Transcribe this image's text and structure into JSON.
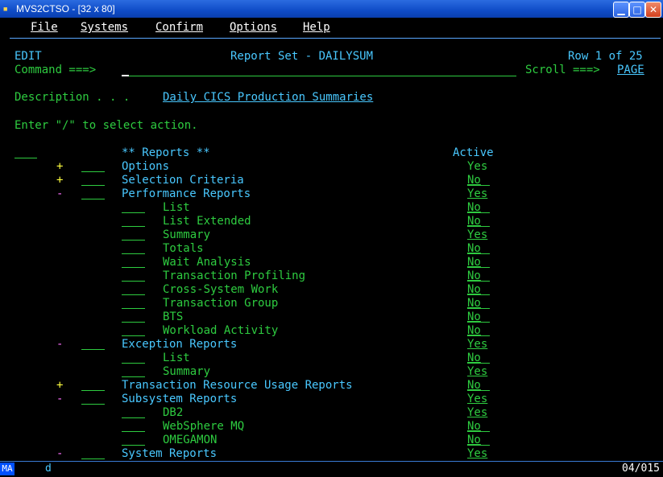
{
  "window": {
    "title": "MVS2CTSO - [32 x 80]"
  },
  "menu": [
    "File",
    "Systems",
    "Confirm",
    "Options",
    "Help"
  ],
  "header": {
    "mode": "EDIT",
    "title": "Report Set - DAILYSUM",
    "row_info": "Row 1 of 25",
    "command_label": "Command ===>",
    "scroll_label": "Scroll ===>",
    "scroll_value": "PAGE"
  },
  "description": {
    "label": "Description . . .",
    "value": "Daily CICS Production Summaries"
  },
  "instruction": "Enter \"/\" to select action.",
  "columns": {
    "reports": "** Reports **",
    "active": "Active"
  },
  "rows": [
    {
      "expander": "+",
      "name": "Options",
      "active": "Yes",
      "level": 0,
      "editable": false
    },
    {
      "expander": "+",
      "name": "Selection Criteria",
      "active": "No",
      "level": 0,
      "editable": true
    },
    {
      "expander": "-",
      "name": "Performance Reports",
      "active": "Yes",
      "level": 0,
      "editable": true
    },
    {
      "expander": "",
      "name": "List",
      "active": "No",
      "level": 1,
      "editable": true
    },
    {
      "expander": "",
      "name": "List Extended",
      "active": "No",
      "level": 1,
      "editable": true
    },
    {
      "expander": "",
      "name": "Summary",
      "active": "Yes",
      "level": 1,
      "editable": true
    },
    {
      "expander": "",
      "name": "Totals",
      "active": "No",
      "level": 1,
      "editable": true
    },
    {
      "expander": "",
      "name": "Wait Analysis",
      "active": "No",
      "level": 1,
      "editable": true
    },
    {
      "expander": "",
      "name": "Transaction Profiling",
      "active": "No",
      "level": 1,
      "editable": true
    },
    {
      "expander": "",
      "name": "Cross-System Work",
      "active": "No",
      "level": 1,
      "editable": true
    },
    {
      "expander": "",
      "name": "Transaction Group",
      "active": "No",
      "level": 1,
      "editable": true
    },
    {
      "expander": "",
      "name": "BTS",
      "active": "No",
      "level": 1,
      "editable": true
    },
    {
      "expander": "",
      "name": "Workload Activity",
      "active": "No",
      "level": 1,
      "editable": true
    },
    {
      "expander": "-",
      "name": "Exception Reports",
      "active": "Yes",
      "level": 0,
      "editable": true
    },
    {
      "expander": "",
      "name": "List",
      "active": "No",
      "level": 1,
      "editable": true
    },
    {
      "expander": "",
      "name": "Summary",
      "active": "Yes",
      "level": 1,
      "editable": true
    },
    {
      "expander": "+",
      "name": "Transaction Resource Usage Reports",
      "active": "No",
      "level": 0,
      "editable": true
    },
    {
      "expander": "-",
      "name": "Subsystem Reports",
      "active": "Yes",
      "level": 0,
      "editable": true
    },
    {
      "expander": "",
      "name": "DB2",
      "active": "Yes",
      "level": 1,
      "editable": true
    },
    {
      "expander": "",
      "name": "WebSphere MQ",
      "active": "No",
      "level": 1,
      "editable": true
    },
    {
      "expander": "",
      "name": "OMEGAMON",
      "active": "No",
      "level": 1,
      "editable": true
    },
    {
      "expander": "-",
      "name": "System Reports",
      "active": "Yes",
      "level": 0,
      "editable": true
    }
  ],
  "status": {
    "indicator": "MA",
    "command": "d",
    "position": "04/015"
  }
}
